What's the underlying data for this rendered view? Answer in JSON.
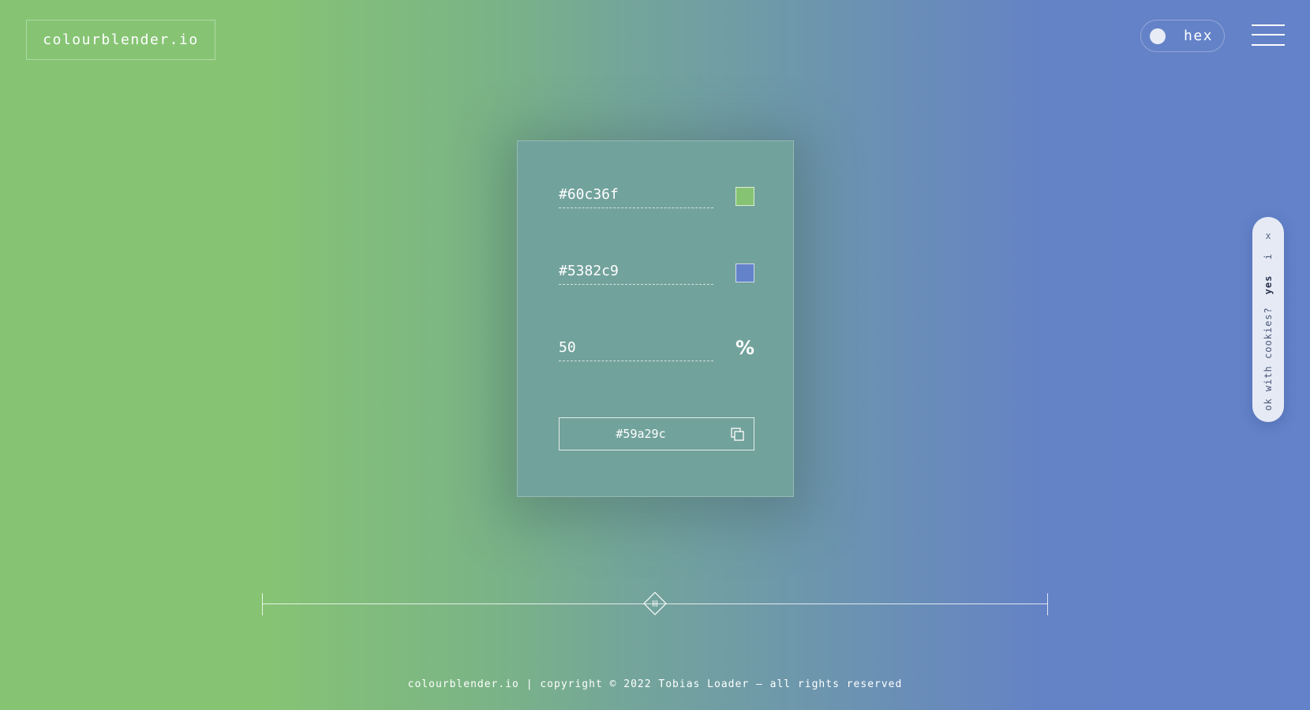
{
  "header": {
    "logo_text": "colourblender.io",
    "mode_label": "hex",
    "menu_icon": "hamburger-menu-icon"
  },
  "blender": {
    "colour_a": {
      "value": "#60c36f",
      "swatch_color": "#86c474"
    },
    "colour_b": {
      "value": "#5382c9",
      "swatch_color": "#6382c9"
    },
    "ratio": {
      "value": "50",
      "unit": "%"
    },
    "result": {
      "value": "#59a29c",
      "copy_icon": "copy-icon"
    }
  },
  "slider": {
    "position_percent": 50,
    "handle_icon": "diamond-grip-icon"
  },
  "cookie_prompt": {
    "close_label": "x",
    "info_label": "i",
    "accept_label": "yes",
    "question": "ok with cookies?"
  },
  "footer": {
    "text": "colourblender.io | copyright © 2022 Tobias Loader — all rights reserved"
  }
}
